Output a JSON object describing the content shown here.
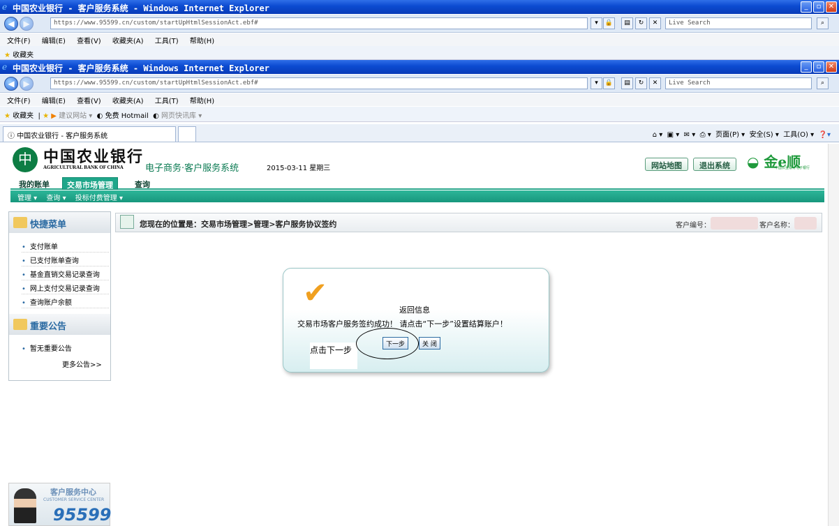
{
  "window": {
    "title": "中国农业银行 - 客户服务系统 - Windows Internet Explorer",
    "address": "https://www.95599.cn/custom/startUpHtmlSessionAct.ebf#",
    "search_placeholder": "Live Search"
  },
  "menu": [
    "文件(F)",
    "编辑(E)",
    "查看(V)",
    "收藏夹(A)",
    "工具(T)",
    "帮助(H)"
  ],
  "favbar": {
    "favorites": "收藏夹",
    "suggested": "建议网站 ▾",
    "hotmail": "免费 Hotmail",
    "gallery": "网页快讯库 ▾"
  },
  "tab": {
    "label": "中国农业银行 - 客户服务系统"
  },
  "toolbar": {
    "page": "页面(P) ▾",
    "safety": "安全(S) ▾",
    "tools": "工具(O) ▾"
  },
  "header": {
    "bank_name": "中国农业银行",
    "bank_name_en": "AGRICULTURAL BANK OF CHINA",
    "system_name": "电子商务·客户服务系统",
    "date": "2015-03-11 星期三",
    "sitemap_button": "网站地图",
    "logout_button": "退出系统",
    "brand": "金e顺",
    "brand_sub": "中国农业银行电子银行"
  },
  "nav": {
    "tabs": [
      "我的账单",
      "交易市场管理",
      "查询"
    ],
    "active_tab": "交易市场管理",
    "subnav": [
      "管理 ▾",
      "查询 ▾",
      "投标付费管理 ▾"
    ]
  },
  "sidebar": {
    "quick_menu": "快捷菜单",
    "quick_items": [
      "支付账单",
      "已支付账单查询",
      "基金直销交易记录查询",
      "网上支付交易记录查询",
      "查询账户余额"
    ],
    "notice_title": "重要公告",
    "notice_items": [
      "暂无重要公告"
    ],
    "more": "更多公告>>"
  },
  "breadcrumb": {
    "text": "您现在的位置是：交易市场管理>管理>客户服务协议签约",
    "customer_id_label": "客户编号：",
    "customer_name_label": "客户名称："
  },
  "dialog": {
    "title": "返回信息",
    "message": "交易市场客户服务签约成功！ 请点击“下一步”设置结算账户！",
    "next_button": "下一步",
    "close_button": "关 闭"
  },
  "annotation": {
    "text": "点击下一步"
  },
  "service_center": {
    "title": "客户服务中心",
    "subtitle": "CUSTOMER SERVICE CENTER",
    "number": "95599"
  }
}
